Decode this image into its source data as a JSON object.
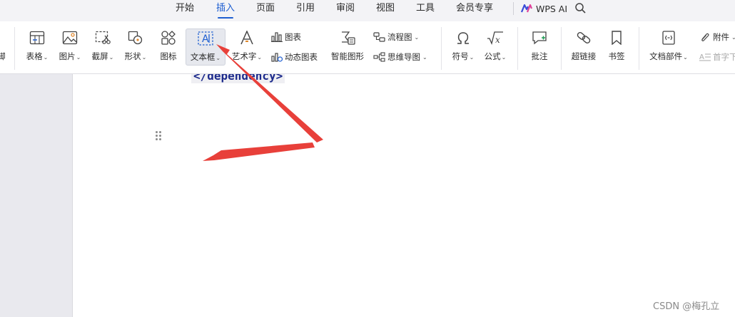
{
  "tabs": [
    {
      "label": "开始",
      "active": false
    },
    {
      "label": "插入",
      "active": true
    },
    {
      "label": "页面",
      "active": false
    },
    {
      "label": "引用",
      "active": false
    },
    {
      "label": "审阅",
      "active": false
    },
    {
      "label": "视图",
      "active": false
    },
    {
      "label": "工具",
      "active": false
    },
    {
      "label": "会员专享",
      "active": false
    }
  ],
  "wps_ai_label": "WPS AI",
  "ribbon": {
    "edge_label": "脚",
    "table": "表格",
    "picture": "图片",
    "screenshot": "截屏",
    "shapes": "形状",
    "icons": "图标",
    "textbox": "文本框",
    "wordart": "艺术字",
    "chart": "图表",
    "dynamic_chart": "动态图表",
    "smart_graphic": "智能图形",
    "flowchart": "流程图",
    "mindmap": "思维导图",
    "symbol": "符号",
    "formula": "公式",
    "comment": "批注",
    "hyperlink": "超链接",
    "bookmark": "书签",
    "doc_parts": "文档部件",
    "attachment": "附件",
    "drop_cap": "首字下"
  },
  "document": {
    "code_fragment": "</dependency>"
  },
  "watermark": "CSDN @梅孔立",
  "colors": {
    "accent": "#1f5fd1",
    "arrow": "#e8403a"
  }
}
